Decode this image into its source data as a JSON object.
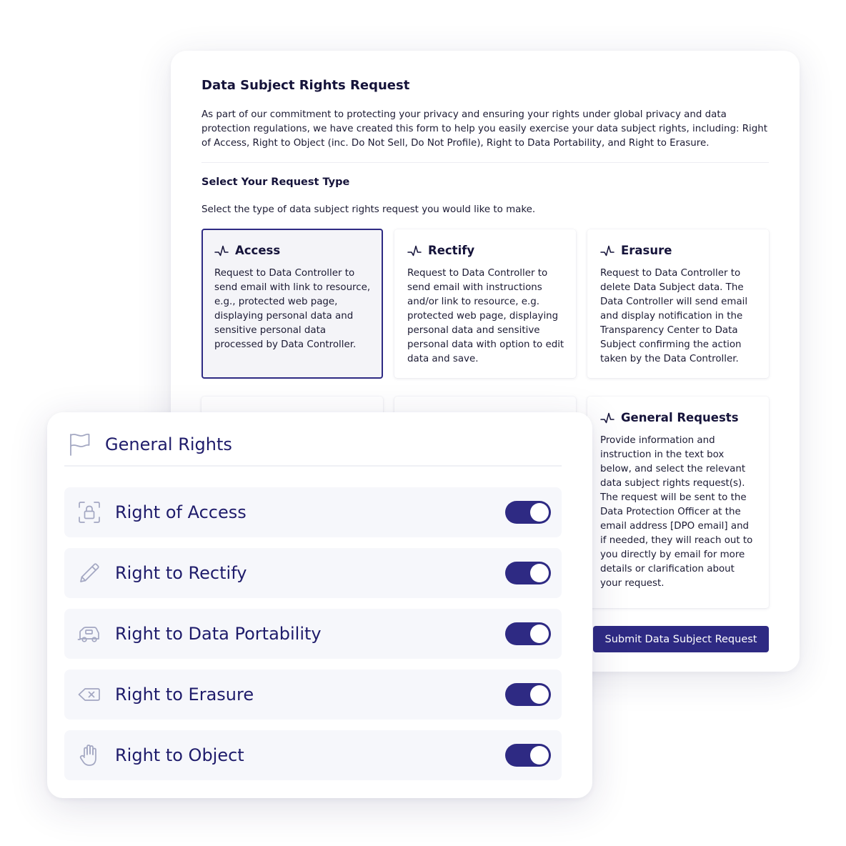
{
  "form": {
    "title": "Data Subject Rights Request",
    "intro": "As part of our commitment to protecting your privacy and ensuring your rights under global privacy and data protection regulations, we have created this form to help you easily exercise your data subject rights, including: Right of Access, Right to Object (inc. Do Not Sell, Do Not Profile), Right to Data Portability, and Right to Erasure.",
    "section_title": "Select Your Request Type",
    "section_desc": "Select the type of data subject rights request you would like to make.",
    "options": [
      {
        "title": "Access",
        "desc": "Request to Data Controller to send email with link to resource, e.g., protected web page, displaying personal data and sensitive personal data processed by Data Controller.",
        "icon": "pulse-icon",
        "selected": true
      },
      {
        "title": "Rectify",
        "desc": "Request to Data Controller to send email with instructions and/or link to resource, e.g. protected web page, displaying personal data and sensitive personal data with option to edit data and save.",
        "icon": "pulse-icon",
        "selected": false
      },
      {
        "title": "Erasure",
        "desc": "Request to Data Controller to delete Data Subject data. The Data Controller will send email and display notification in the Transparency Center to Data Subject confirming the action taken by the Data Controller.",
        "icon": "pulse-icon",
        "selected": false
      },
      {
        "title": "General Requests",
        "desc": "Provide information and instruction in the text box below, and select the relevant data subject rights request(s). The request will be sent to the Data Protection Officer at the email address [DPO email] and if needed, they will reach out to you directly by email for more details or clarification about your request.",
        "icon": "pulse-icon",
        "selected": false
      }
    ],
    "submit_label": "Submit Data Subject Request"
  },
  "rights": {
    "title": "General Rights",
    "icon": "flag-icon",
    "items": [
      {
        "label": "Right of Access",
        "icon": "lock-scan-icon",
        "enabled": true
      },
      {
        "label": "Right to Rectify",
        "icon": "pencil-icon",
        "enabled": true
      },
      {
        "label": "Right to Data Portability",
        "icon": "camper-van-icon",
        "enabled": true
      },
      {
        "label": "Right to Erasure",
        "icon": "backspace-icon",
        "enabled": true
      },
      {
        "label": "Right to Object",
        "icon": "hand-stop-icon",
        "enabled": true
      }
    ]
  },
  "colors": {
    "accent": "#2e2a83",
    "heading": "#15133a",
    "rights_text": "#1f1c6b",
    "row_bg": "#f6f7fb",
    "icon_gray": "#a3a7c2"
  }
}
